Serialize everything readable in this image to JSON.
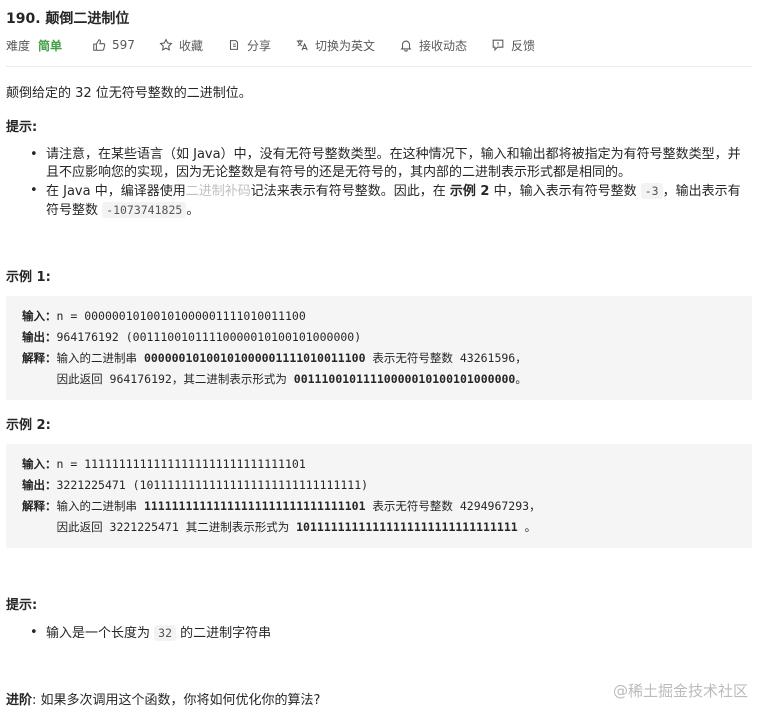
{
  "problem": {
    "title": "190. 颠倒二进制位",
    "difficulty_label": "难度",
    "difficulty": "简单",
    "likes": "597",
    "favorite": "收藏",
    "share": "分享",
    "switch_lang": "切换为英文",
    "subscribe": "接收动态",
    "feedback": "反馈",
    "accent_color": "#43a047"
  },
  "description": "颠倒给定的 32 位无符号整数的二进制位。",
  "tips_heading": "提示:",
  "tips": {
    "t1": "请注意，在某些语言（如 Java）中，没有无符号整数类型。在这种情况下，输入和输出都将被指定为有符号整数类型，并且不应影响您的实现，因为无论整数是有符号的还是无符号的，其内部的二进制表示形式都是相同的。",
    "t2_a": "在 Java 中，编译器使用",
    "t2_link": "二进制补码",
    "t2_b": "记法来表示有符号整数。因此，在 ",
    "t2_bold": "示例 2",
    "t2_c": " 中，输入表示有符号整数 ",
    "t2_code1": "-3",
    "t2_d": "，输出表示有符号整数 ",
    "t2_code2": "-1073741825",
    "t2_e": "。"
  },
  "example1": {
    "heading": "示例 1:",
    "in_label": "输入：",
    "in_val": "n = 00000010100101000001111010011100",
    "out_label": "输出：",
    "out_val": "964176192 (00111001011110000010100101000000)",
    "exp_label": "解释：",
    "exp_a": "输入的二进制串 ",
    "exp_b": "00000010100101000001111010011100",
    "exp_c": " 表示无符号整数 43261596，",
    "exp_d": "     因此返回 964176192，其二进制表示形式为 ",
    "exp_e": "00111001011110000010100101000000",
    "exp_f": "。"
  },
  "example2": {
    "heading": "示例 2:",
    "in_label": "输入：",
    "in_val": "n = 11111111111111111111111111111101",
    "out_label": "输出：",
    "out_val": "3221225471 (10111111111111111111111111111111)",
    "exp_label": "解释：",
    "exp_a": "输入的二进制串 ",
    "exp_b": "11111111111111111111111111111101",
    "exp_c": " 表示无符号整数 4294967293，",
    "exp_d": "     因此返回 3221225471 其二进制表示形式为 ",
    "exp_e": "10111111111111111111111111111111",
    "exp_f": " 。"
  },
  "hints_heading": "提示:",
  "hint1_a": "输入是一个长度为 ",
  "hint1_code": "32",
  "hint1_b": " 的二进制字符串",
  "advanced_label": "进阶",
  "advanced_text": ": 如果多次调用这个函数，你将如何优化你的算法?",
  "watermark": "@稀土掘金技术社区"
}
